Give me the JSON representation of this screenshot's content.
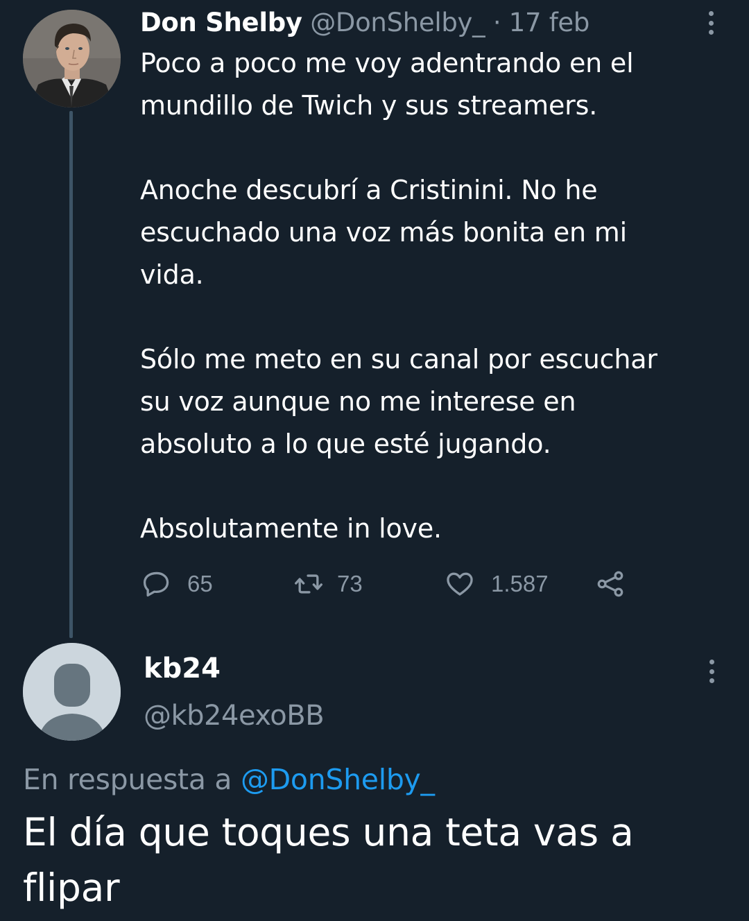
{
  "tweet": {
    "author_name": "Don Shelby",
    "handle": "@DonShelby_",
    "separator": "·",
    "date": "17 feb",
    "text": "Poco a poco me voy adentrando en el\nmundillo de Twich y sus streamers.\n\nAnoche descubrí a Cristinini. No he\nescuchado una voz más bonita en mi\nvida.\n\nSólo me meto en su canal por escuchar\nsu voz aunque no me interese en\nabsoluto a lo que esté jugando.\n\nAbsolutamente in love.",
    "actions": {
      "replies": "65",
      "retweets": "73",
      "likes": "1.587"
    }
  },
  "reply": {
    "author_name": "kb24",
    "handle": "@kb24exoBB",
    "replying_prefix": "En respuesta a",
    "replying_to": "@DonShelby_",
    "text": "El día que toques una teta vas a flipar"
  },
  "colors": {
    "background": "#15202b",
    "secondary_text": "#8b98a5",
    "link": "#1d9bf0",
    "thread_line": "#3d5466"
  },
  "icons": [
    "more-icon",
    "reply-icon",
    "retweet-icon",
    "like-icon",
    "share-icon",
    "default-avatar-icon"
  ]
}
